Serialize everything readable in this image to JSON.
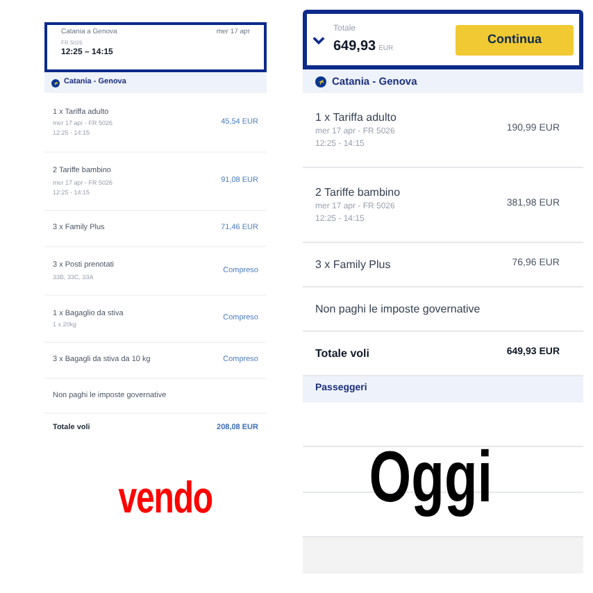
{
  "left_screen": {
    "header": {
      "route": "Catania a Genova",
      "date": "mer 17 apr",
      "flight": "FR 5026",
      "times": "12:25 – 14:15"
    },
    "section_title": "Catania - Genova",
    "items": [
      {
        "kind": "line",
        "title": "1 x Tariffa adulto",
        "details": [
          "mer 17 apr - FR 5026",
          "12:25 - 14:15"
        ],
        "price": "45,54 EUR"
      },
      {
        "kind": "line",
        "title": "2 Tariffe bambino",
        "details": [
          "mer 17 apr - FR 5026",
          "12:25 - 14:15"
        ],
        "price": "91,08 EUR"
      },
      {
        "kind": "line",
        "title": "3 x Family Plus",
        "price": "71,46 EUR"
      },
      {
        "kind": "line",
        "title": "3 x Posti prenotati",
        "details": [
          "33B, 33C, 33A"
        ],
        "price": "Compreso"
      },
      {
        "kind": "line",
        "title": "1 x Bagaglio da stiva",
        "details": [
          "1 x 20kg"
        ],
        "price": "Compreso"
      },
      {
        "kind": "line",
        "title": "3 x Bagagli da stiva da 10 kg",
        "price": "Compreso"
      },
      {
        "kind": "note",
        "title": "Non paghi le imposte governative"
      }
    ],
    "total": {
      "label": "Totale voli",
      "value": "208,08 EUR"
    },
    "caption": "vendo"
  },
  "right_screen": {
    "header": {
      "label": "Totale",
      "amount": "649,93",
      "currency": "EUR",
      "button": "Continua"
    },
    "section_title": "Catania - Genova",
    "items": [
      {
        "kind": "line",
        "title": "1 x Tariffa adulto",
        "details": [
          "mer 17 apr - FR 5026",
          "12:25 - 14:15"
        ],
        "price": "190,99 EUR"
      },
      {
        "kind": "line",
        "title": "2 Tariffe bambino",
        "details": [
          "mer 17 apr - FR 5026",
          "12:25 - 14:15"
        ],
        "price": "381,98 EUR"
      },
      {
        "kind": "line",
        "title": "3 x Family Plus",
        "price": "76,96 EUR"
      },
      {
        "kind": "note",
        "title": "Non paghi le imposte governative"
      }
    ],
    "total": {
      "label": "Totale voli",
      "value": "649,93 EUR"
    },
    "passengers_section": "Passeggeri",
    "caption": "Oggi"
  }
}
